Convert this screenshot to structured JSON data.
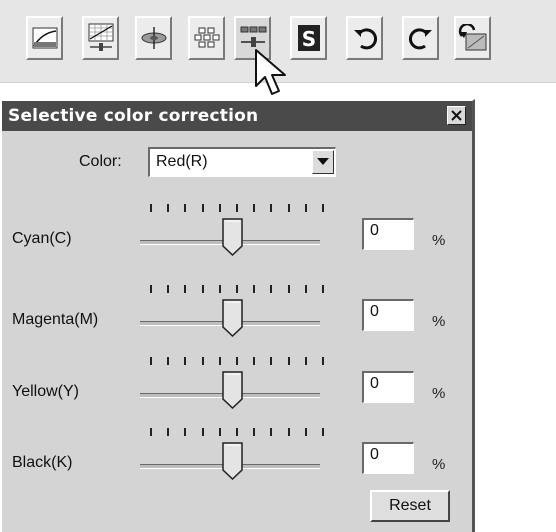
{
  "toolbar": {
    "buttons": [
      {
        "name": "tone-curve-icon"
      },
      {
        "name": "histogram-icon"
      },
      {
        "name": "color-wheel-icon"
      },
      {
        "name": "variation-icon"
      },
      {
        "name": "selective-color-icon"
      },
      {
        "name": "saturation-icon"
      },
      {
        "name": "undo-icon"
      },
      {
        "name": "redo-icon"
      },
      {
        "name": "reset-image-icon"
      }
    ]
  },
  "dialog": {
    "title": "Selective color correction",
    "color_label": "Color:",
    "color_value": "Red(R)",
    "reset_label": "Reset",
    "sliders": [
      {
        "label": "Cyan(C)",
        "value": "0",
        "unit": "%",
        "level": 0
      },
      {
        "label": "Magenta(M)",
        "value": "0",
        "unit": "%",
        "level": 0
      },
      {
        "label": "Yellow(Y)",
        "value": "0",
        "unit": "%",
        "level": 0
      },
      {
        "label": "Black(K)",
        "value": "0",
        "unit": "%",
        "level": 0
      }
    ]
  }
}
